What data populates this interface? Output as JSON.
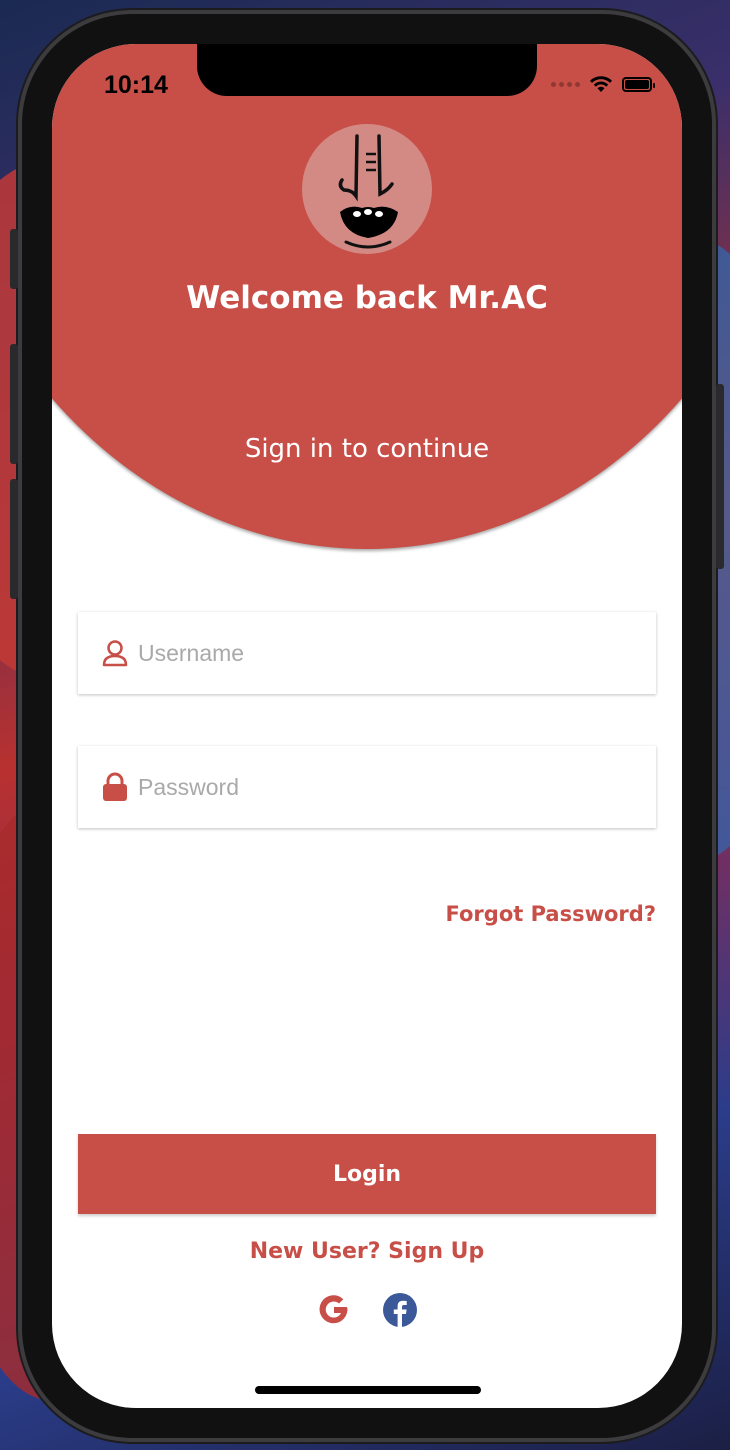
{
  "status_bar": {
    "time": "10:14"
  },
  "header": {
    "welcome_text": "Welcome back Mr.AC",
    "subtitle": "Sign in to continue"
  },
  "form": {
    "username_placeholder": "Username",
    "password_placeholder": "Password",
    "forgot_password_label": "Forgot Password?",
    "login_label": "Login",
    "signup_label": "New User? Sign Up"
  },
  "colors": {
    "primary": "#c84f47",
    "placeholder": "#a9a9a9",
    "facebook": "#3b5998"
  },
  "social": {
    "icons": [
      "google-icon",
      "facebook-icon"
    ]
  }
}
